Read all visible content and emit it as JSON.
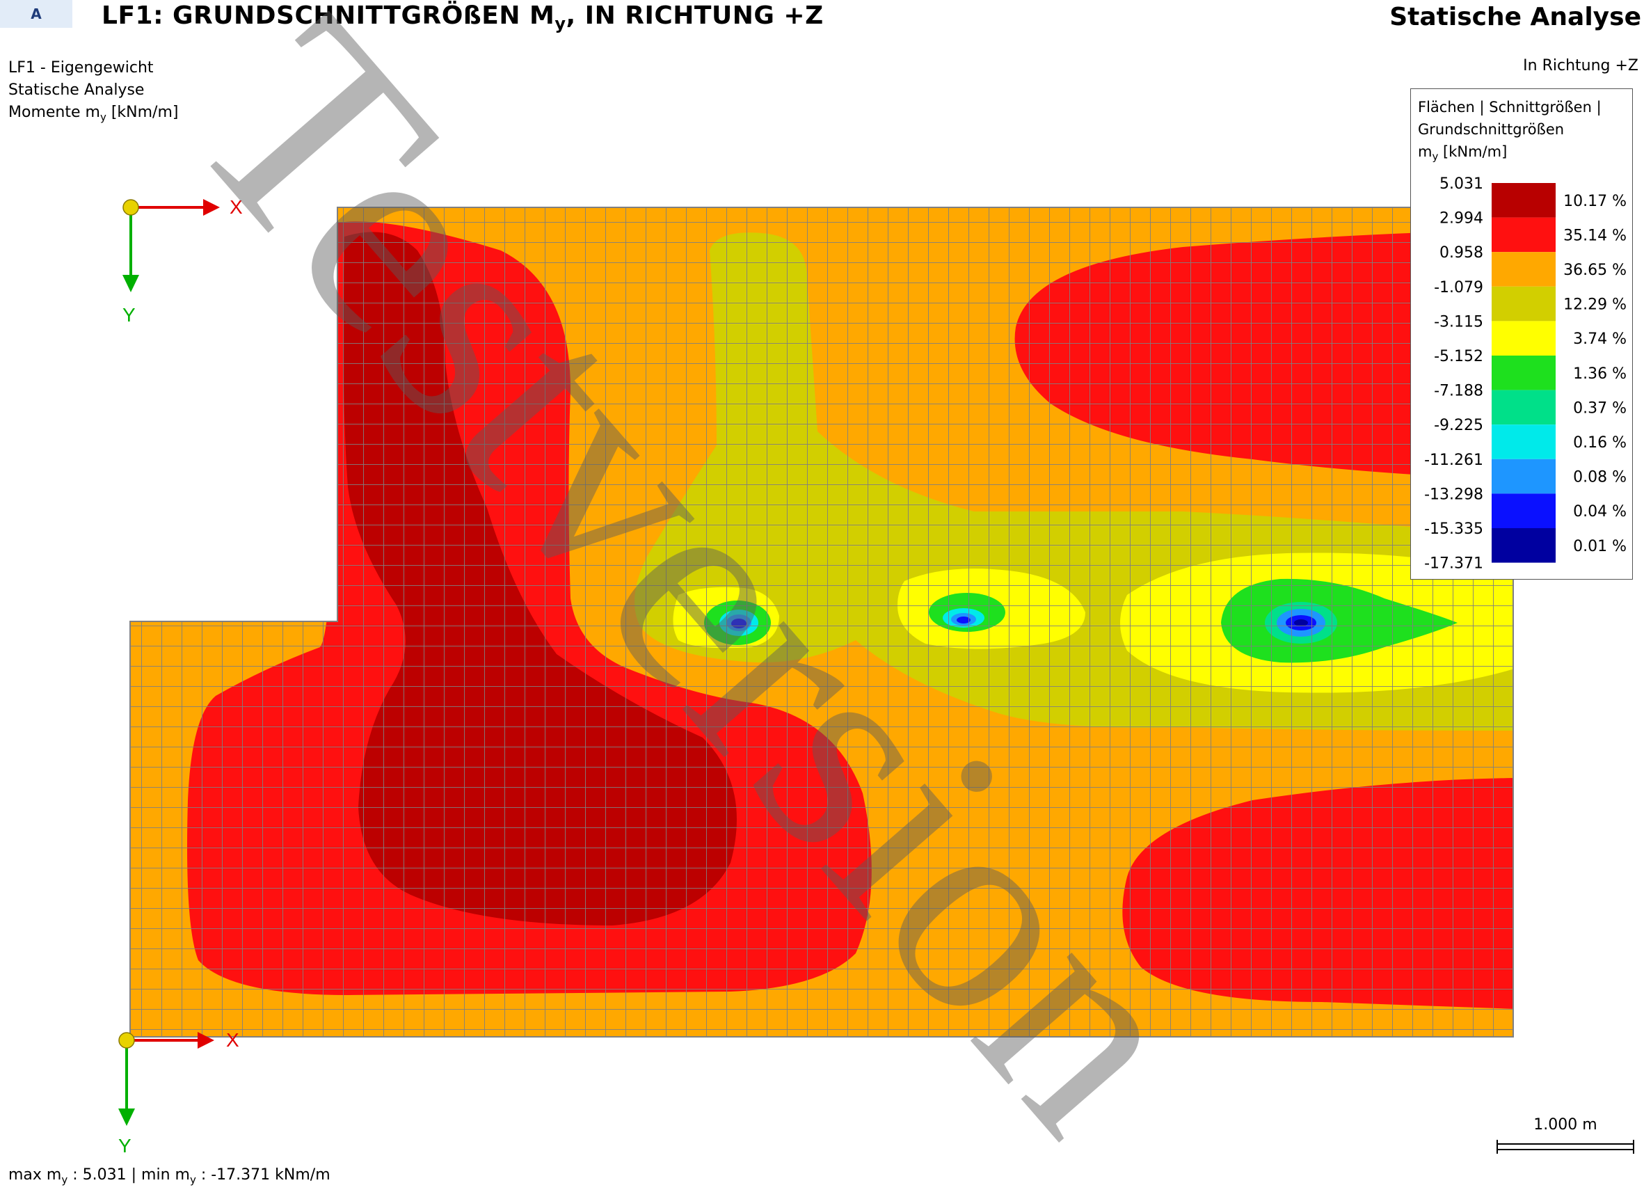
{
  "header": {
    "tab": "A",
    "title": "LF1: GRUNDSCHNITTGRÖßEN M",
    "title_sub": "y",
    "title_rest": ", IN RICHTUNG +Z",
    "app": "Statische Analyse"
  },
  "info": {
    "line1": "LF1 - Eigengewicht",
    "line2": "Statische Analyse",
    "line3_pre": "Momente m",
    "line3_sub": "y",
    "line3_post": " [kNm/m]"
  },
  "direction": "In Richtung +Z",
  "legend": {
    "title_line1": "Flächen | Schnittgrößen |",
    "title_line2": "Grundschnittgrößen",
    "title_line3_pre": "m",
    "title_line3_sub": "y",
    "title_line3_post": " [kNm/m]",
    "values": [
      "5.031",
      "2.994",
      "0.958",
      "-1.079",
      "-3.115",
      "-5.152",
      "-7.188",
      "-9.225",
      "-11.261",
      "-13.298",
      "-15.335",
      "-17.371"
    ],
    "colors": [
      "#b80000",
      "#ff1010",
      "#ffa800",
      "#d2cf00",
      "#ffff00",
      "#1ee01e",
      "#00e089",
      "#00eaea",
      "#1e96ff",
      "#0a10ff",
      "#0000a0"
    ],
    "percents": [
      "10.17 %",
      "35.14 %",
      "36.65 %",
      "12.29 %",
      "3.74 %",
      "1.36 %",
      "0.37 %",
      "0.16 %",
      "0.08 %",
      "0.04 %",
      "0.01 %"
    ]
  },
  "axes": {
    "x": "X",
    "y": "Y"
  },
  "scale": "1.000 m",
  "stats": {
    "max_pre": "max m",
    "max_sub": "y",
    "max_val": " : 5.031 | min m",
    "min_sub": "y",
    "min_val": " : -17.371 kNm/m"
  },
  "watermark": "Testversion",
  "icons": {
    "origin": "yellow-sphere-icon",
    "x_axis": "red-arrow-icon",
    "y_axis": "green-arrow-icon"
  }
}
